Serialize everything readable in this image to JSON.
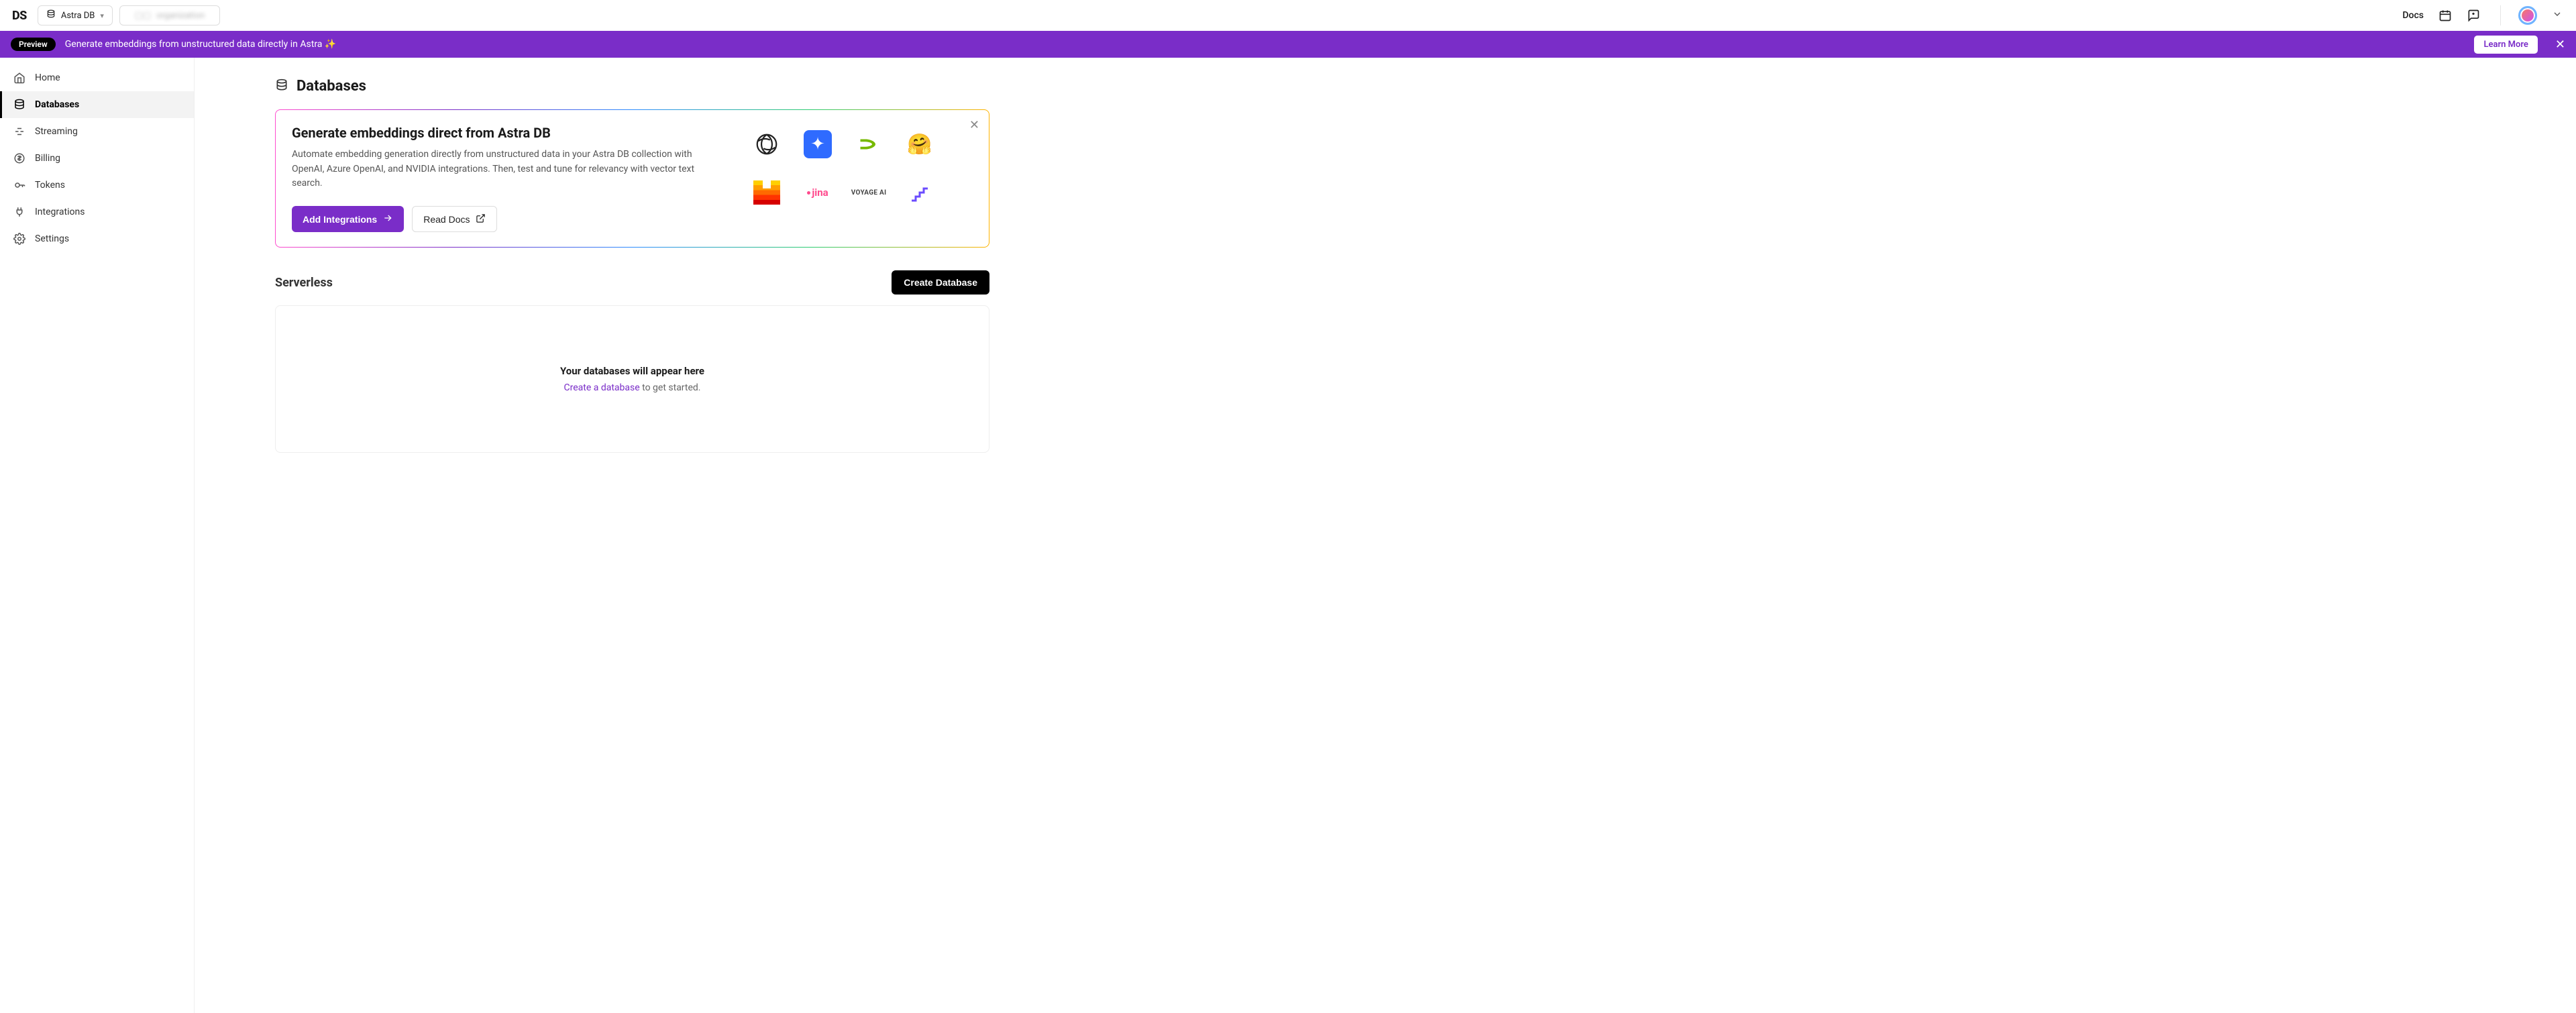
{
  "topbar": {
    "logo": "DS",
    "product_selector": {
      "label": "Astra DB"
    },
    "org_selector": {
      "label": "organization"
    },
    "docs_link": "Docs"
  },
  "banner": {
    "badge": "Preview",
    "text": "Generate embeddings from unstructured data directly in Astra ✨",
    "learn_more": "Learn More"
  },
  "sidebar": {
    "items": [
      {
        "label": "Home"
      },
      {
        "label": "Databases"
      },
      {
        "label": "Streaming"
      },
      {
        "label": "Billing"
      },
      {
        "label": "Tokens"
      },
      {
        "label": "Integrations"
      },
      {
        "label": "Settings"
      }
    ]
  },
  "page": {
    "title": "Databases"
  },
  "promo": {
    "title": "Generate embeddings direct from Astra DB",
    "description": "Automate embedding generation directly from unstructured data in your Astra DB collection with OpenAI, Azure OpenAI, and NVIDIA integrations. Then, test and tune for relevancy with vector text search.",
    "add_integrations": "Add Integrations",
    "read_docs": "Read Docs",
    "providers": {
      "jina": "jina",
      "voyage": "VOYAGE AI"
    }
  },
  "serverless": {
    "title": "Serverless",
    "create_button": "Create Database",
    "empty_title": "Your databases will appear here",
    "empty_link": "Create a database",
    "empty_rest": " to get started."
  }
}
